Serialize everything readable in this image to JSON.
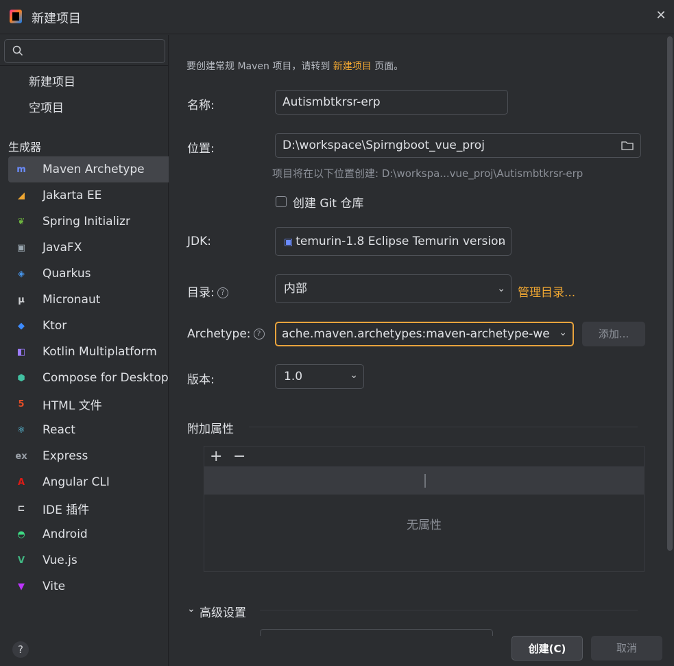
{
  "window": {
    "title": "新建项目",
    "close_label": "✕"
  },
  "sidebar": {
    "search": {
      "placeholder": "",
      "value": ""
    },
    "top_items": [
      {
        "label": "新建项目"
      },
      {
        "label": "空项目"
      }
    ],
    "generators_label": "生成器",
    "generators": [
      {
        "label": "Maven Archetype",
        "icon": "maven-icon",
        "glyph": "m",
        "color": "#6b8cff",
        "selected": true
      },
      {
        "label": "Jakarta EE",
        "icon": "jakarta-ee-icon",
        "glyph": "◢",
        "color": "#f0a732"
      },
      {
        "label": "Spring Initializr",
        "icon": "spring-icon",
        "glyph": "❦",
        "color": "#6db33f"
      },
      {
        "label": "JavaFX",
        "icon": "javafx-icon",
        "glyph": "▣",
        "color": "#9aa7b0"
      },
      {
        "label": "Quarkus",
        "icon": "quarkus-icon",
        "glyph": "◈",
        "color": "#4695eb"
      },
      {
        "label": "Micronaut",
        "icon": "micronaut-icon",
        "glyph": "μ",
        "color": "#cfd1d4"
      },
      {
        "label": "Ktor",
        "icon": "ktor-icon",
        "glyph": "◆",
        "color": "#3d8bfd"
      },
      {
        "label": "Kotlin Multiplatform",
        "icon": "kotlin-multiplatform-icon",
        "glyph": "◧",
        "color": "#9d7cff"
      },
      {
        "label": "Compose for Desktop",
        "icon": "compose-icon",
        "glyph": "⬢",
        "color": "#42c1a2"
      },
      {
        "label": "HTML 文件",
        "icon": "html5-icon",
        "glyph": "5",
        "color": "#e44d26"
      },
      {
        "label": "React",
        "icon": "react-icon",
        "glyph": "⚛",
        "color": "#61dafb"
      },
      {
        "label": "Express",
        "icon": "express-icon",
        "glyph": "ex",
        "color": "#9aa0a8"
      },
      {
        "label": "Angular CLI",
        "icon": "angular-icon",
        "glyph": "A",
        "color": "#dd1b16"
      },
      {
        "label": "IDE 插件",
        "icon": "plugin-icon",
        "glyph": "⊏",
        "color": "#cfd1d4"
      },
      {
        "label": "Android",
        "icon": "android-icon",
        "glyph": "◓",
        "color": "#3ddc84"
      },
      {
        "label": "Vue.js",
        "icon": "vue-icon",
        "glyph": "V",
        "color": "#41b883"
      },
      {
        "label": "Vite",
        "icon": "vite-icon",
        "glyph": "▼",
        "color": "#bd34fe"
      }
    ],
    "help_label": "?"
  },
  "form": {
    "hint_prefix": "要创建常规 Maven 项目，请转到 ",
    "hint_link": "新建项目",
    "hint_suffix": " 页面。",
    "name": {
      "label": "名称:",
      "value": "Autismbtkrsr-erp"
    },
    "location": {
      "label": "位置:",
      "value": "D:\\workspace\\Spirngboot_vue_proj",
      "subhint": "项目将在以下位置创建: D:\\workspa...vue_proj\\Autismbtkrsr-erp"
    },
    "git": {
      "label": "创建 Git 仓库",
      "checked": false
    },
    "jdk": {
      "label": "JDK:",
      "value": "temurin-1.8 Eclipse Temurin version"
    },
    "catalog": {
      "label": "目录:",
      "value": "内部",
      "manage_link": "管理目录..."
    },
    "archetype": {
      "label": "Archetype:",
      "value": "ache.maven.archetypes:maven-archetype-webap",
      "add_button": "添加..."
    },
    "version": {
      "label": "版本:",
      "value": "1.0"
    },
    "extra_props": {
      "title": "附加属性",
      "add": "+",
      "remove": "−",
      "empty": "无属性"
    },
    "advanced": {
      "title": "高级设置"
    }
  },
  "footer": {
    "create_label": "创建(C)",
    "cancel_label": "取消"
  },
  "colors": {
    "accent": "#f0a732",
    "background": "#2b2d30",
    "selected": "#43454a"
  }
}
